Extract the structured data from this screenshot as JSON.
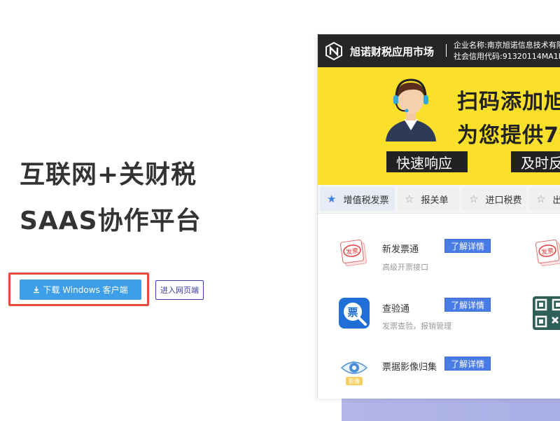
{
  "hero": {
    "title_line1": "互联网+关财税",
    "title_line2": "SAAS协作平台",
    "download_button": "下载 Windows 客户端",
    "web_button": "进入网页端"
  },
  "preview": {
    "brand": "旭诺财税应用市场",
    "company_name": "企业名称:南京旭诺信息技术有限",
    "credit_code": "社会信用代码:91320114MA1M",
    "banner": {
      "line1": "扫码添加旭",
      "line2": "为您提供7*",
      "tag1": "快速响应",
      "tag2": "及时反"
    },
    "tabs": [
      {
        "label": "增值税发票",
        "active": true
      },
      {
        "label": "报关单",
        "active": false
      },
      {
        "label": "进口税费",
        "active": false
      },
      {
        "label": "出",
        "active": false
      }
    ],
    "cards": [
      {
        "title": "新发票通",
        "desc": "高级开票接口",
        "button": "了解详情",
        "icon": "invoice-stamp-icon",
        "icon_text": "发票"
      },
      {
        "title": "查验通",
        "desc": "发票查验，报销管理",
        "button": "了解详情",
        "icon": "ticket-search-icon",
        "icon_text": "票"
      },
      {
        "title": "票据影像归集",
        "desc": "",
        "button": "了解详情",
        "icon": "eye-image-icon",
        "icon_text": "影像"
      }
    ],
    "side_icons": [
      {
        "icon": "invoice-stamp-icon",
        "icon_text": "发票"
      },
      {
        "icon": "qr-code-icon"
      }
    ]
  },
  "colors": {
    "primary_blue": "#3e9fe8",
    "highlight_red": "#e74c3c",
    "banner_yellow": "#fbe02b",
    "header_dark": "#262626",
    "detail_button": "#4a7ce8"
  }
}
